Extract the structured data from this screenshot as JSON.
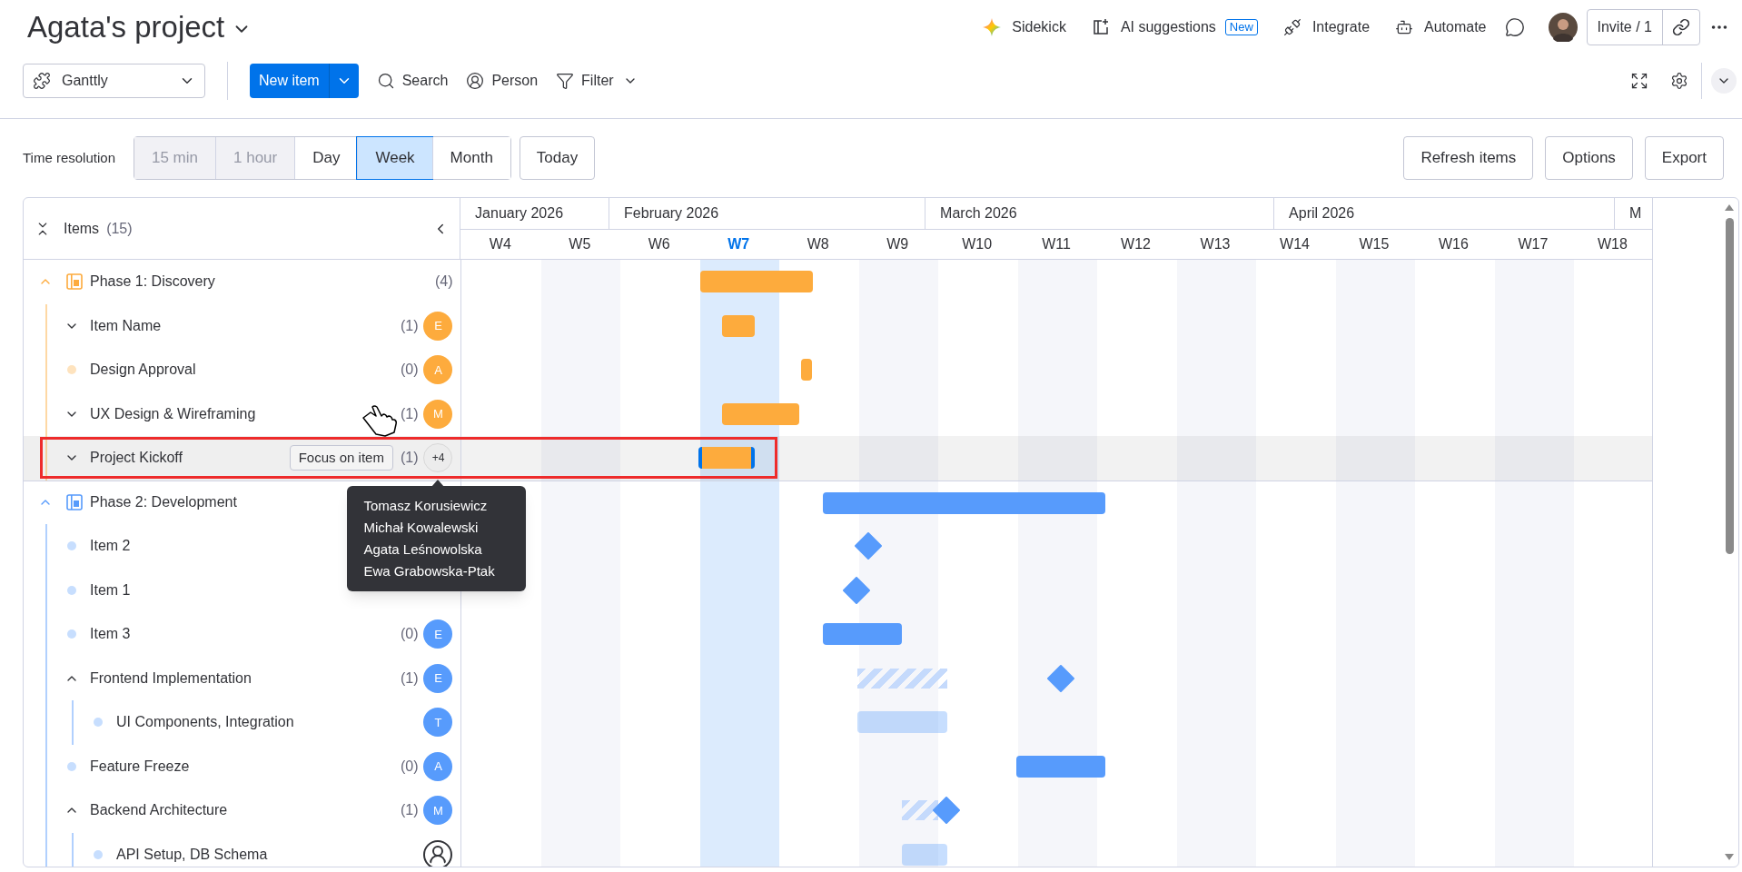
{
  "header": {
    "title": "Agata's project"
  },
  "top_actions": [
    {
      "kind": "sidekick",
      "label": "Sidekick"
    },
    {
      "kind": "ai",
      "label": "AI suggestions",
      "badge": "New"
    },
    {
      "kind": "integrate",
      "label": "Integrate"
    },
    {
      "kind": "automate",
      "label": "Automate"
    }
  ],
  "invite": {
    "label": "Invite / 1"
  },
  "toolbar": {
    "view": "Ganttly",
    "new_item": "New item",
    "tools": [
      {
        "kind": "search",
        "label": "Search"
      },
      {
        "kind": "person",
        "label": "Person"
      },
      {
        "kind": "filter",
        "label": "Filter"
      }
    ]
  },
  "time_resolution": {
    "label": "Time resolution",
    "options": [
      {
        "label": "15 min",
        "disabled": true,
        "selected": false
      },
      {
        "label": "1 hour",
        "disabled": true,
        "selected": false
      },
      {
        "label": "Day",
        "disabled": false,
        "selected": false
      },
      {
        "label": "Week",
        "disabled": false,
        "selected": true
      },
      {
        "label": "Month",
        "disabled": false,
        "selected": false
      }
    ],
    "today": "Today"
  },
  "actions": [
    "Refresh items",
    "Options",
    "Export"
  ],
  "items_panel": {
    "title": "Items",
    "count": "(15)"
  },
  "timeline": {
    "months": [
      "January 2026",
      "February 2026",
      "March 2026",
      "April 2026",
      "M"
    ],
    "weeks": [
      {
        "label": "W4",
        "current": false
      },
      {
        "label": "W5",
        "current": false
      },
      {
        "label": "W6",
        "current": false
      },
      {
        "label": "W7",
        "current": true
      },
      {
        "label": "W8",
        "current": false
      },
      {
        "label": "W9",
        "current": false
      },
      {
        "label": "W10",
        "current": false
      },
      {
        "label": "W11",
        "current": false
      },
      {
        "label": "W12",
        "current": false
      },
      {
        "label": "W13",
        "current": false
      },
      {
        "label": "W14",
        "current": false
      },
      {
        "label": "W15",
        "current": false
      },
      {
        "label": "W16",
        "current": false
      },
      {
        "label": "W17",
        "current": false
      },
      {
        "label": "W18",
        "current": false
      }
    ]
  },
  "groups": [
    {
      "label": "Phase 1: Discovery",
      "count": "(4)",
      "color": "#fdab3d",
      "expanded": true,
      "kind": "solid",
      "items": [
        {
          "label": "Item Name",
          "count": "(1)",
          "avatar": {
            "kind": "letter",
            "text": "E"
          },
          "expanded": false,
          "kind": "solid"
        },
        {
          "label": "Design Approval",
          "count": "(0)",
          "avatar": {
            "kind": "letter",
            "text": "A"
          },
          "kind": "solid"
        },
        {
          "label": "UX Design & Wireframing",
          "count": "(1)",
          "avatar": {
            "kind": "letter",
            "text": "M"
          },
          "expanded": false,
          "kind": "solid"
        },
        {
          "label": "Project Kickoff",
          "count": "(1)",
          "avatar": {
            "kind": "more",
            "text": "+4"
          },
          "expanded": false,
          "highlighted": true,
          "focus_button": "Focus on item",
          "tooltip": [
            "Tomasz Korusiewicz",
            "Michał Kowalewski",
            "Agata Leśnowolska",
            "Ewa Grabowska-Ptak"
          ],
          "kind": "solid"
        }
      ]
    },
    {
      "label": "Phase 2: Development",
      "color": "#579bfc",
      "expanded": true,
      "kind": "solid",
      "items": [
        {
          "label": "Item 2",
          "kind": "milestone"
        },
        {
          "label": "Item 1",
          "kind": "milestone"
        },
        {
          "label": "Item 3",
          "count": "(0)",
          "avatar": {
            "kind": "letter",
            "text": "E"
          },
          "kind": "solid"
        },
        {
          "label": "Frontend Implementation",
          "count": "(1)",
          "avatar": {
            "kind": "letter",
            "text": "E"
          },
          "expanded": true,
          "kind": "planned",
          "children": [
            {
              "label": "UI Components, Integration",
              "avatar": {
                "kind": "letter",
                "text": "T"
              },
              "kind": "faded"
            }
          ]
        },
        {
          "label": "Feature Freeze",
          "count": "(0)",
          "avatar": {
            "kind": "letter",
            "text": "A"
          },
          "kind": "solid"
        },
        {
          "label": "Backend Architecture",
          "count": "(1)",
          "avatar": {
            "kind": "letter",
            "text": "M"
          },
          "expanded": true,
          "kind": "planned",
          "children": [
            {
              "label": "API Setup, DB Schema",
              "avatar": {
                "kind": "empty"
              },
              "kind": "faded"
            }
          ]
        }
      ]
    }
  ]
}
